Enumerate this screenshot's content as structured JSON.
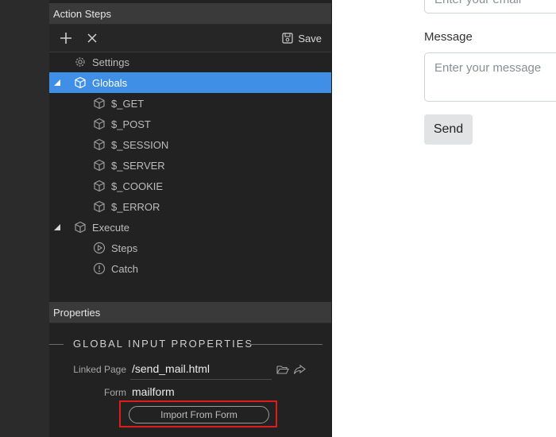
{
  "panel": {
    "action_steps_header": "Action Steps",
    "properties_header": "Properties",
    "toolbar": {
      "save_label": "Save"
    }
  },
  "tree": {
    "settings": "Settings",
    "globals": "Globals",
    "globals_children": [
      "$_GET",
      "$_POST",
      "$_SESSION",
      "$_SERVER",
      "$_COOKIE",
      "$_ERROR"
    ],
    "execute": "Execute",
    "steps": "Steps",
    "catch": "Catch"
  },
  "properties": {
    "section_title": "GLOBAL INPUT PROPERTIES",
    "linked_page_label": "Linked Page",
    "linked_page_value": "/send_mail.html",
    "form_label": "Form",
    "form_value": "mailform",
    "import_button": "Import From Form"
  },
  "form": {
    "email_placeholder": "Enter your email",
    "message_label": "Message",
    "message_placeholder": "Enter your message",
    "send_button": "Send"
  },
  "colors": {
    "selection": "#3f8fe6",
    "panel_bg": "#222222",
    "highlight_box": "#e01b1b"
  }
}
